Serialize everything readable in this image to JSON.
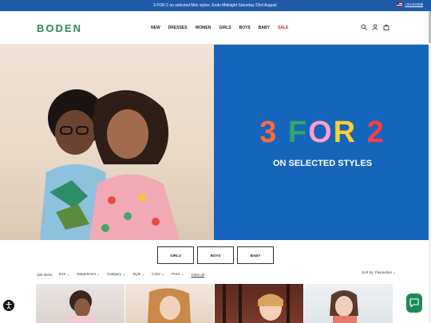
{
  "promo": {
    "text": "3 FOR 2 on selected Mini styles. Ends Midnight Saturday 23rd August.",
    "locale": "USA/USD$"
  },
  "header": {
    "logo": "BODEN",
    "nav": [
      "NEW",
      "DRESSES",
      "WOMEN",
      "GIRLS",
      "BOYS",
      "BABY",
      "SALE"
    ],
    "icons": [
      "search-icon",
      "account-icon",
      "bag-icon"
    ]
  },
  "hero": {
    "headline_chars": [
      "3",
      " ",
      "F",
      "O",
      "R",
      " ",
      "2"
    ],
    "subheadline": "ON SELECTED STYLES"
  },
  "categories": [
    "GIRLS",
    "BOYS",
    "BABY"
  ],
  "filters": {
    "count": "160 items",
    "options": [
      "Size",
      "Department",
      "Category",
      "Style",
      "Color",
      "Price"
    ],
    "clear": "Clear all",
    "sort": "Sort by: Favourites"
  },
  "colors": {
    "promo": "#1f5ba8",
    "hero_panel": "#1665bd",
    "logo": "#2b8a57",
    "sale": "#d12a2a",
    "chat": "#1e8a58"
  }
}
